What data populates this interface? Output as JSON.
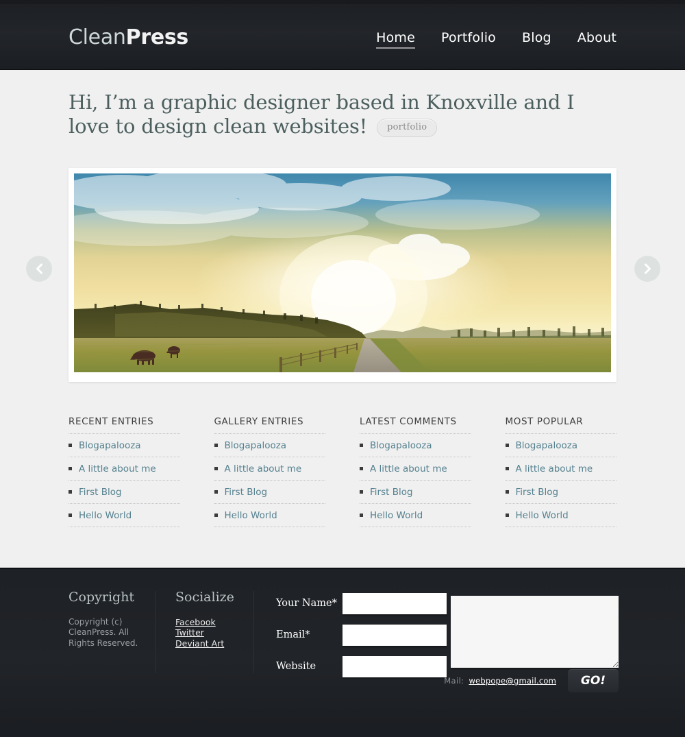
{
  "top_strip": {
    "color": "#181a1d"
  },
  "header": {
    "logo": {
      "first": "Clean",
      "second": "Press"
    },
    "nav": [
      {
        "label": "Home",
        "active": true
      },
      {
        "label": "Portfolio",
        "active": false
      },
      {
        "label": "Blog",
        "active": false
      },
      {
        "label": "About",
        "active": false
      }
    ]
  },
  "hero": {
    "title": "Hi, I’m a graphic designer based in Knoxville and I love to design clean websites!",
    "pill_label": "portfolio",
    "title_color": "#4c5f5e"
  },
  "slider": {
    "prev_icon": "chevron-left-icon",
    "next_icon": "chevron-right-icon",
    "slide_alt": "Rural landscape at sunset with blue sky fading to golden glow, rolling dark hills, grazing cattle in a golden field, fence line and a road receding to the horizon"
  },
  "columns": [
    {
      "title": "RECENT ENTRIES",
      "links": [
        "Blogapalooza",
        "A little about me",
        "First Blog",
        "Hello World"
      ]
    },
    {
      "title": "GALLERY ENTRIES",
      "links": [
        "Blogapalooza",
        "A little about me",
        "First Blog",
        "Hello World"
      ]
    },
    {
      "title": "LATEST COMMENTS",
      "links": [
        "Blogapalooza",
        "A little about me",
        "First Blog",
        "Hello World"
      ]
    },
    {
      "title": "MOST POPULAR",
      "links": [
        "Blogapalooza",
        "A little about me",
        "First Blog",
        "Hello World"
      ]
    }
  ],
  "footer": {
    "copyright": {
      "heading": "Copyright",
      "text": "Copyright (c) CleanPress.  All Rights Reserved."
    },
    "socialize": {
      "heading": "Socialize",
      "links": [
        "Facebook",
        "Twitter",
        "Deviant Art"
      ]
    },
    "form": {
      "fields": [
        {
          "label": "Your Name*",
          "value": "",
          "placeholder": ""
        },
        {
          "label": "Email*",
          "value": "",
          "placeholder": ""
        },
        {
          "label": "Website",
          "value": "",
          "placeholder": ""
        }
      ],
      "message": {
        "value": "",
        "placeholder": ""
      },
      "mail_label": "Mail:",
      "mail_address": "webpope@gmail.com",
      "submit_label": "GO!"
    }
  },
  "colors": {
    "page_bg": "#f0f0f0",
    "header_bg": "#202327",
    "link_teal": "#55818f",
    "heading_slate": "#4c5f5e"
  }
}
